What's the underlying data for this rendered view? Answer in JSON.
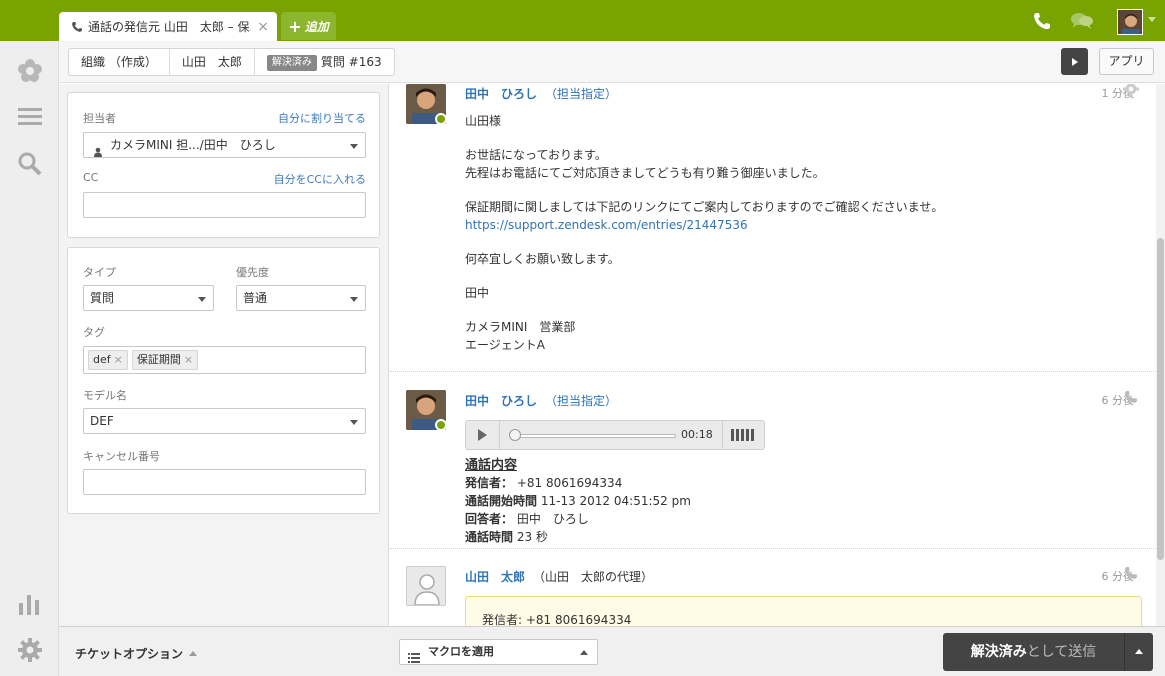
{
  "topbar": {
    "active_tab_title": "通話の発信元 山田　太郎 – 保...",
    "add_tab_label": "追加",
    "colors": {
      "brand": "#78a300"
    }
  },
  "subheader": {
    "crumbs": [
      "組織 （作成）",
      "山田　太郎"
    ],
    "status_badge": "解決済み",
    "ticket_label": "質問 #163",
    "apps_label": "アプリ"
  },
  "props": {
    "assignee": {
      "label": "担当者",
      "self_assign_link": "自分に割り当てる",
      "value": "カメラMINI 担.../田中　ひろし"
    },
    "cc": {
      "label": "CC",
      "self_cc_link": "自分をCCに入れる"
    },
    "type": {
      "label": "タイプ",
      "value": "質問"
    },
    "priority": {
      "label": "優先度",
      "value": "普通"
    },
    "tags": {
      "label": "タグ",
      "values": [
        "def",
        "保証期間"
      ]
    },
    "model": {
      "label": "モデル名",
      "value": "DEF"
    },
    "cancel_no": {
      "label": "キャンセル番号"
    }
  },
  "comments": [
    {
      "author": "田中　ひろし",
      "role": "（担当指定）",
      "time": "1 分後",
      "lines": [
        "山田様",
        "お世話になっております。",
        "先程はお電話にてご対応頂きましてどうも有り難う御座いました。",
        "保証期間に関しましては下記のリンクにてご案内しておりますのでご確認くださいませ。",
        "https://support.zendesk.com/entries/21447536",
        "何卒宜しくお願い致します。",
        "田中",
        "カメラMINI　営業部",
        "エージェントA"
      ]
    },
    {
      "author": "田中　ひろし",
      "role": "（担当指定）",
      "time": "6 分後",
      "audio_time": "00:18",
      "call_title": "通話内容",
      "call_fields": [
        {
          "label": "発信者：",
          "value": "+81 8061694334"
        },
        {
          "label": "通話開始時間",
          "value": "11-13 2012 04:51:52 pm"
        },
        {
          "label": "回答者：",
          "value": "田中　ひろし"
        },
        {
          "label": "通話時間",
          "value": "23 秒"
        }
      ]
    },
    {
      "author": "山田　太郎",
      "role": "（山田　太郎の代理）",
      "time": "6 分後",
      "box_text": "発信者: +81 8061694334"
    }
  ],
  "footer": {
    "ticket_options": "チケットオプション",
    "macro": "マクロを適用",
    "submit_strong": "解決済み",
    "submit_rest": "として送信"
  }
}
